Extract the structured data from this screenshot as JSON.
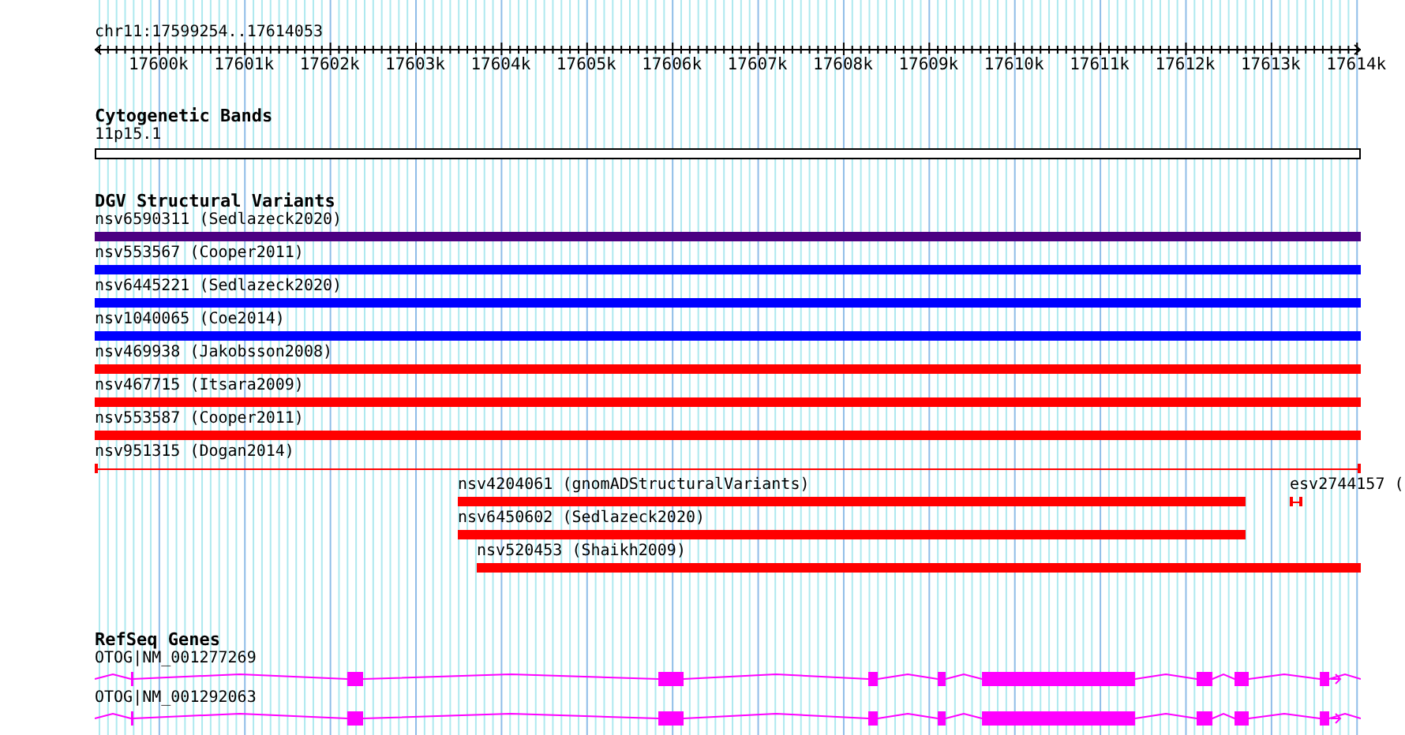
{
  "view": {
    "region": "chr11:17599254..17614053"
  },
  "ruler": {
    "ticks": [
      {
        "label": "17600k"
      },
      {
        "label": "17601k"
      },
      {
        "label": "17602k"
      },
      {
        "label": "17603k"
      },
      {
        "label": "17604k"
      },
      {
        "label": "17605k"
      },
      {
        "label": "17606k"
      },
      {
        "label": "17607k"
      },
      {
        "label": "17608k"
      },
      {
        "label": "17609k"
      },
      {
        "label": "17610k"
      },
      {
        "label": "17611k"
      },
      {
        "label": "17612k"
      },
      {
        "label": "17613k"
      },
      {
        "label": "17614k"
      }
    ]
  },
  "tracks": [
    {
      "kind": "bands",
      "title": "Cytogenetic Bands",
      "features": [
        {
          "label": "11p15.1"
        }
      ]
    },
    {
      "kind": "variants",
      "title": "DGV Structural Variants",
      "features": [
        {
          "label": "nsv6590311 (Sedlazeck2020)",
          "kind": "bar",
          "color": "#4b0082"
        },
        {
          "label": "nsv553567 (Cooper2011)",
          "kind": "bar",
          "color": "#0000ff"
        },
        {
          "label": "nsv6445221 (Sedlazeck2020)",
          "kind": "bar",
          "color": "#0000ff"
        },
        {
          "label": "nsv1040065 (Coe2014)",
          "kind": "bar",
          "color": "#0000ff"
        },
        {
          "label": "nsv469938 (Jakobsson2008)",
          "kind": "bar",
          "color": "#ff0000"
        },
        {
          "label": "nsv467715 (Itsara2009)",
          "kind": "bar",
          "color": "#ff0000"
        },
        {
          "label": "nsv553587 (Cooper2011)",
          "kind": "bar",
          "color": "#ff0000"
        },
        {
          "label": "nsv951315 (Dogan2014)",
          "kind": "thin",
          "color": "#ff0000"
        },
        {
          "label": "nsv4204061 (gnomADStructuralVariants)",
          "kind": "bar",
          "color": "#ff0000"
        },
        {
          "label": "esv2744157 (",
          "kind": "thin",
          "color": "#ff0000"
        },
        {
          "label": "nsv6450602 (Sedlazeck2020)",
          "kind": "bar",
          "color": "#ff0000"
        },
        {
          "label": "nsv520453 (Shaikh2009)",
          "kind": "bar",
          "color": "#ff0000"
        }
      ]
    },
    {
      "kind": "genes",
      "title": "RefSeq Genes",
      "features": [
        {
          "label": "OTOG|NM_001277269",
          "forward": true
        },
        {
          "label": "OTOG|NM_001292063",
          "forward": true
        }
      ]
    }
  ]
}
